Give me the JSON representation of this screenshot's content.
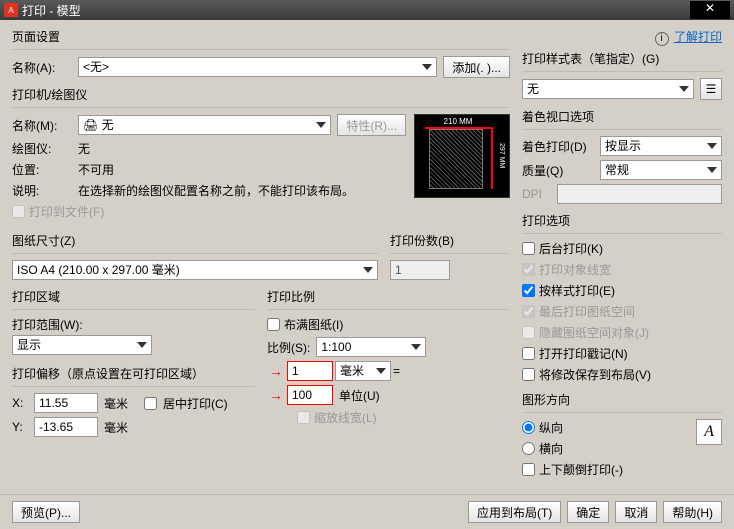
{
  "title": "打印 - 模型",
  "learn_link": "了解打印",
  "page_setup": {
    "heading": "页面设置",
    "name_label": "名称(A):",
    "name_value": "<无>",
    "add_btn": "添加(. )..."
  },
  "printer": {
    "heading": "打印机/绘图仪",
    "name_label": "名称(M):",
    "name_value": "🖨 无",
    "props_btn": "特性(R)...",
    "plotter_label": "绘图仪:",
    "plotter_value": "无",
    "where_label": "位置:",
    "where_value": "不可用",
    "desc_label": "说明:",
    "desc_value": "在选择新的绘图仪配置名称之前，不能打印该布局。",
    "to_file": "打印到文件(F)",
    "preview_w": "210 MM",
    "preview_h": "297 MM"
  },
  "paper": {
    "heading": "图纸尺寸(Z)",
    "value": "ISO A4 (210.00 x 297.00 毫米)"
  },
  "copies": {
    "heading": "打印份数(B)",
    "value": "1"
  },
  "area": {
    "heading": "打印区域",
    "what_label": "打印范围(W):",
    "what_value": "显示"
  },
  "scale": {
    "heading": "打印比例",
    "fit": "布满图纸(I)",
    "label": "比例(S):",
    "value": "1:100",
    "mm_value": "1",
    "mm_unit": "毫米",
    "unit_value": "100",
    "unit_label": "单位(U)",
    "lw": "缩放线宽(L)",
    "eq": "="
  },
  "offset": {
    "heading": "打印偏移（原点设置在可打印区域）",
    "x_label": "X:",
    "x_value": "11.55",
    "y_label": "Y:",
    "y_value": "-13.65",
    "unit": "毫米",
    "center": "居中打印(C)"
  },
  "style": {
    "heading": "打印样式表（笔指定）(G)",
    "value": "无"
  },
  "shade": {
    "heading": "着色视口选项",
    "mode_label": "着色打印(D)",
    "mode_value": "按显示",
    "quality_label": "质量(Q)",
    "quality_value": "常规",
    "dpi_label": "DPI"
  },
  "options": {
    "heading": "打印选项",
    "bg": "后台打印(K)",
    "lw": "打印对象线宽",
    "style": "按样式打印(E)",
    "paperspace": "最后打印图纸空间",
    "hidepaperspace": "隐藏图纸空间对象(J)",
    "stamp": "打开打印戳记(N)",
    "savechanges": "将修改保存到布局(V)"
  },
  "orient": {
    "heading": "图形方向",
    "portrait": "纵向",
    "landscape": "横向",
    "upside": "上下颠倒打印(-)"
  },
  "footer": {
    "preview": "预览(P)...",
    "apply": "应用到布局(T)",
    "ok": "确定",
    "cancel": "取消",
    "help": "帮助(H)"
  }
}
